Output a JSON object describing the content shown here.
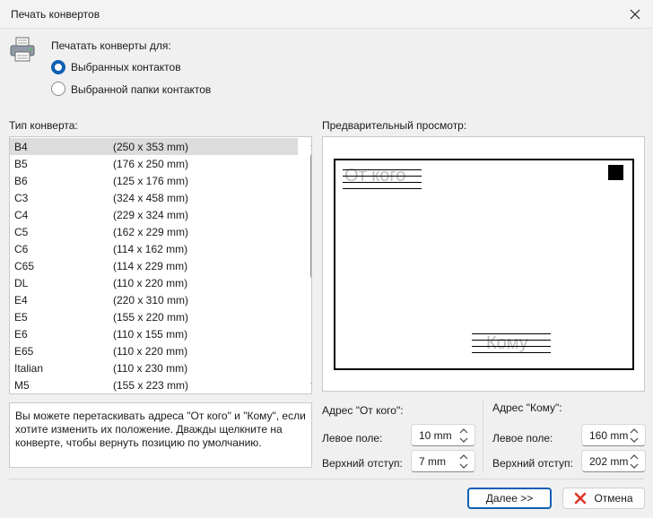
{
  "window": {
    "title": "Печать конвертов"
  },
  "print_for": {
    "label": "Печатать конверты для:",
    "options": [
      {
        "label": "Выбранных контактов",
        "checked": true
      },
      {
        "label": "Выбранной папки контактов",
        "checked": false
      }
    ]
  },
  "envelope_type": {
    "label": "Тип конверта:",
    "items": [
      {
        "name": "B4",
        "size": "(250 x 353 mm)"
      },
      {
        "name": "B5",
        "size": "(176 x 250 mm)"
      },
      {
        "name": "B6",
        "size": "(125 x 176 mm)"
      },
      {
        "name": "C3",
        "size": "(324 x 458 mm)"
      },
      {
        "name": "C4",
        "size": "(229 x 324 mm)"
      },
      {
        "name": "C5",
        "size": "(162 x 229 mm)"
      },
      {
        "name": "C6",
        "size": "(114 x 162 mm)"
      },
      {
        "name": "C65",
        "size": "(114 x 229 mm)"
      },
      {
        "name": "DL",
        "size": "(110 x 220 mm)"
      },
      {
        "name": "E4",
        "size": "(220 x 310 mm)"
      },
      {
        "name": "E5",
        "size": "(155 x 220 mm)"
      },
      {
        "name": "E6",
        "size": "(110 x 155 mm)"
      },
      {
        "name": "E65",
        "size": "(110 x 220 mm)"
      },
      {
        "name": "Italian",
        "size": "(110 x 230 mm)"
      },
      {
        "name": "M5",
        "size": "(155 x 223 mm)"
      }
    ],
    "selected": "B4"
  },
  "hint": "Вы можете перетаскивать адреса \"От кого\" и \"Кому\", если хотите изменить их положение. Дважды щелкните на конверте, чтобы вернуть позицию по умолчанию.",
  "preview": {
    "label": "Предварительный просмотр:",
    "from_text": "От кого",
    "to_text": "Кому"
  },
  "from_address": {
    "label": "Адрес \"От кого\":",
    "left_label": "Левое поле:",
    "left_value": "10 mm",
    "top_label": "Верхний отступ:",
    "top_value": "7 mm"
  },
  "to_address": {
    "label": "Адрес \"Кому\":",
    "left_label": "Левое поле:",
    "left_value": "160 mm",
    "top_label": "Верхний отступ:",
    "top_value": "202 mm"
  },
  "buttons": {
    "next": "Далее >>",
    "cancel": "Отмена"
  },
  "colors": {
    "accent": "#0f5fb5",
    "cancel_icon": "#e0362c"
  }
}
